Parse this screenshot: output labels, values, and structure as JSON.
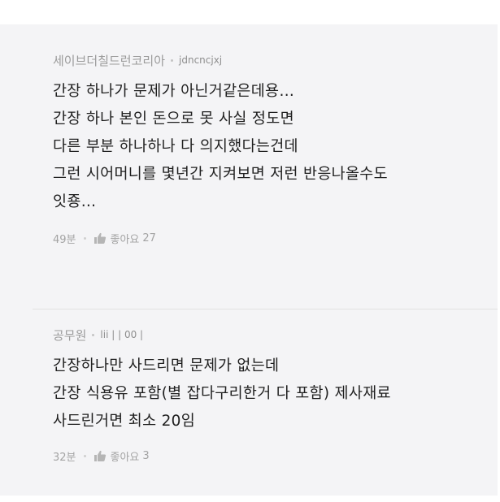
{
  "comments": [
    {
      "author": "세이브더칠드런코리아",
      "user_id": "jdncncjxj",
      "lines": [
        "간장 하나가 문제가 아닌거같은데용…",
        "간장 하나 본인 돈으로 못 사실 정도면",
        "다른 부분 하나하나 다 의지했다는건데",
        "그런 시어머니를 몇년간 지켜보면 저런 반응나올수도",
        "잇죵…"
      ],
      "time": "49분",
      "like_label": "좋아요",
      "like_count": "27"
    },
    {
      "author": "공무원",
      "user_id": "lii |  | 00 |",
      "lines": [
        "간장하나만 사드리면 문제가 없는데",
        "간장 식용유 포함(별 잡다구리한거 다 포함) 제사재료",
        "사드린거면 최소 20임"
      ],
      "time": "32분",
      "like_label": "좋아요",
      "like_count": "3"
    }
  ]
}
